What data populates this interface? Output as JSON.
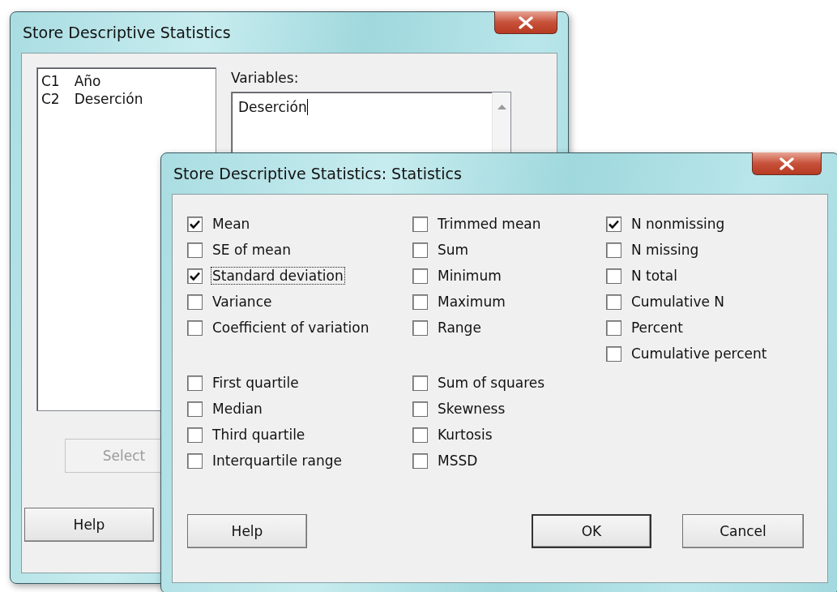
{
  "back_dialog": {
    "title": "Store Descriptive Statistics",
    "columns_list": [
      {
        "column": "C1",
        "name": "Año"
      },
      {
        "column": "C2",
        "name": "Deserción"
      }
    ],
    "variables_label": "Variables:",
    "variables_value": "Deserción",
    "buttons": [
      {
        "label": "Select",
        "disabled": true
      },
      {
        "label": "Help",
        "disabled": false
      }
    ]
  },
  "statistics_dialog": {
    "title": "Store Descriptive Statistics: Statistics",
    "columns": [
      {
        "groups": [
          [
            {
              "label": "Mean",
              "checked": true,
              "focused": false
            },
            {
              "label": "SE of mean",
              "checked": false,
              "focused": false
            },
            {
              "label": "Standard deviation",
              "checked": true,
              "focused": true
            },
            {
              "label": "Variance",
              "checked": false,
              "focused": false
            },
            {
              "label": "Coefficient of variation",
              "checked": false,
              "focused": false
            }
          ],
          [
            {
              "label": "First quartile",
              "checked": false,
              "focused": false
            },
            {
              "label": "Median",
              "checked": false,
              "focused": false
            },
            {
              "label": "Third quartile",
              "checked": false,
              "focused": false
            },
            {
              "label": "Interquartile range",
              "checked": false,
              "focused": false
            }
          ]
        ]
      },
      {
        "groups": [
          [
            {
              "label": "Trimmed mean",
              "checked": false,
              "focused": false
            },
            {
              "label": "Sum",
              "checked": false,
              "focused": false
            },
            {
              "label": "Minimum",
              "checked": false,
              "focused": false
            },
            {
              "label": "Maximum",
              "checked": false,
              "focused": false
            },
            {
              "label": "Range",
              "checked": false,
              "focused": false
            }
          ],
          [
            {
              "label": "Sum of squares",
              "checked": false,
              "focused": false
            },
            {
              "label": "Skewness",
              "checked": false,
              "focused": false
            },
            {
              "label": "Kurtosis",
              "checked": false,
              "focused": false
            },
            {
              "label": "MSSD",
              "checked": false,
              "focused": false
            }
          ]
        ]
      },
      {
        "groups": [
          [
            {
              "label": "N nonmissing",
              "checked": true,
              "focused": false
            },
            {
              "label": "N missing",
              "checked": false,
              "focused": false
            },
            {
              "label": "N total",
              "checked": false,
              "focused": false
            },
            {
              "label": "Cumulative N",
              "checked": false,
              "focused": false
            },
            {
              "label": "Percent",
              "checked": false,
              "focused": false
            },
            {
              "label": "Cumulative percent",
              "checked": false,
              "focused": false
            }
          ]
        ]
      }
    ],
    "buttons": [
      {
        "kind": "help",
        "label": "Help",
        "default": false
      },
      {
        "kind": "ok",
        "label": "OK",
        "default": true
      },
      {
        "kind": "cancel",
        "label": "Cancel",
        "default": false
      }
    ]
  }
}
